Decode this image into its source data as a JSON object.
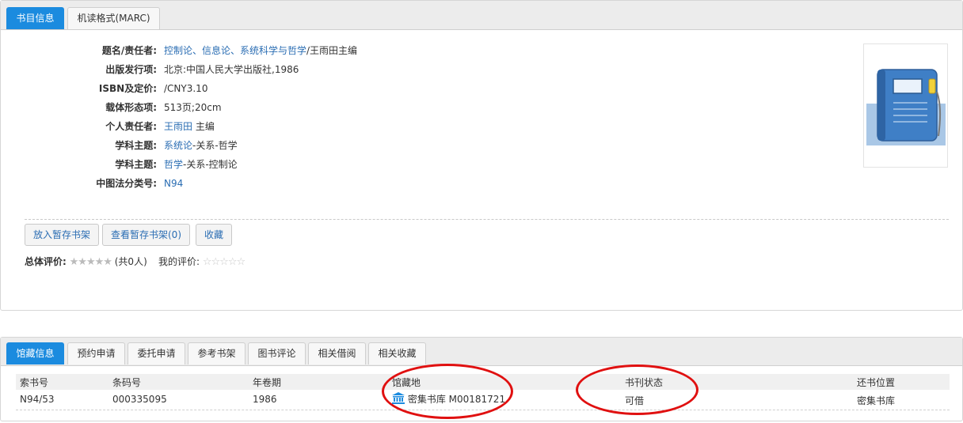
{
  "top_tabs": [
    {
      "label": "书目信息",
      "active": true
    },
    {
      "label": "机读格式(MARC)",
      "active": false
    }
  ],
  "fields": [
    {
      "label": "题名/责任者:",
      "value_link": "控制论、信息论、系统科学与哲学",
      "value_rest": "/王雨田主编"
    },
    {
      "label": "出版发行项:",
      "value_link": "",
      "value_rest": "北京:中国人民大学出版社,1986"
    },
    {
      "label": "ISBN及定价:",
      "value_link": "",
      "value_rest": "/CNY3.10"
    },
    {
      "label": "载体形态项:",
      "value_link": "",
      "value_rest": "513页;20cm"
    },
    {
      "label": "个人责任者:",
      "value_link": "王雨田",
      "value_rest": " 主编"
    },
    {
      "label": "学科主题:",
      "value_link": "系统论",
      "value_rest": "-关系-哲学"
    },
    {
      "label": "学科主题:",
      "value_link": "哲学",
      "value_rest": "-关系-控制论"
    },
    {
      "label": "中图法分类号:",
      "value_link": "N94",
      "value_rest": ""
    }
  ],
  "buttons": {
    "add_shelf": "放入暂存书架",
    "view_shelf": "查看暂存书架(0)",
    "favorite": "收藏"
  },
  "rating": {
    "overall_label": "总体评价:",
    "overall_stars": "★★★★★",
    "overall_count": "(共0人)",
    "mine_label": "我的评价:",
    "mine_stars": "☆☆☆☆☆"
  },
  "bottom_tabs": [
    {
      "label": "馆藏信息",
      "active": true
    },
    {
      "label": "预约申请",
      "active": false
    },
    {
      "label": "委托申请",
      "active": false
    },
    {
      "label": "参考书架",
      "active": false
    },
    {
      "label": "图书评论",
      "active": false
    },
    {
      "label": "相关借阅",
      "active": false
    },
    {
      "label": "相关收藏",
      "active": false
    }
  ],
  "holdings": {
    "columns": [
      "索书号",
      "条码号",
      "年卷期",
      "馆藏地",
      "书刊状态",
      "还书位置"
    ],
    "rows": [
      {
        "call_number": "N94/53",
        "barcode": "000335095",
        "year_volume": "1986",
        "location": "密集书库 M00181721",
        "status": "可借",
        "return_location": "密集书库"
      }
    ]
  },
  "colors": {
    "accent": "#1b8bdf",
    "link": "#2a6db3",
    "available": "#2e9a2e",
    "annotation": "#e01010"
  },
  "icons": {
    "cover": "book-cover-icon",
    "location": "library-building-icon",
    "star": "star-icon"
  }
}
